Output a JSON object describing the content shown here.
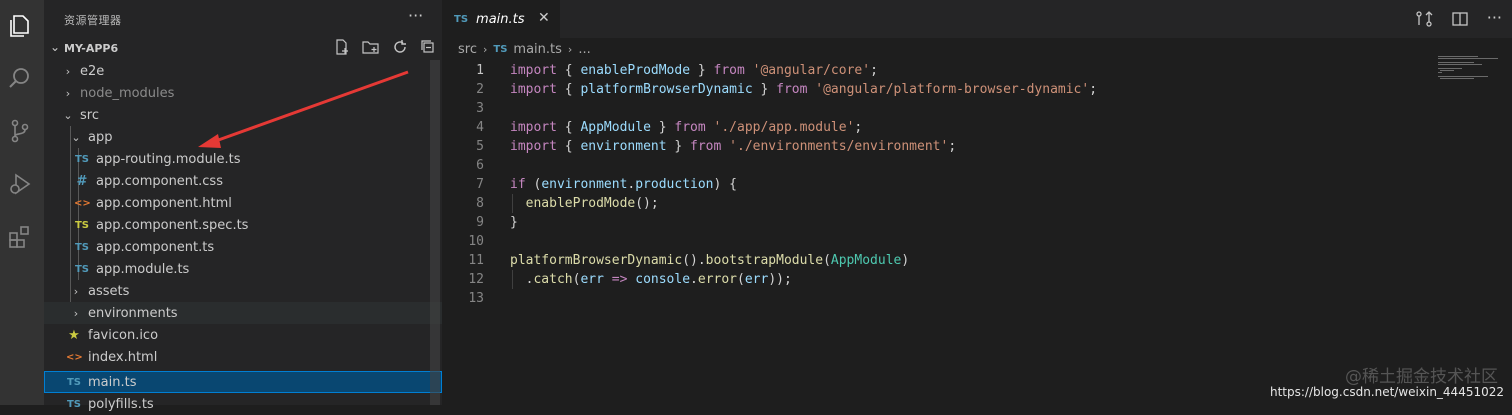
{
  "sidebar": {
    "title": "资源管理器",
    "more": "···",
    "section_title": "MY-APP6",
    "items": [
      {
        "label": "e2e",
        "chev": "›",
        "icon": ""
      },
      {
        "label": "node_modules",
        "chev": "›",
        "icon": ""
      },
      {
        "label": "src",
        "chev": "⌄",
        "icon": ""
      },
      {
        "label": "app",
        "chev": "⌄",
        "icon": ""
      },
      {
        "label": "app-routing.module.ts",
        "chev": "",
        "icon": "TS"
      },
      {
        "label": "app.component.css",
        "chev": "",
        "icon": "#"
      },
      {
        "label": "app.component.html",
        "chev": "",
        "icon": "<>"
      },
      {
        "label": "app.component.spec.ts",
        "chev": "",
        "icon": "TS"
      },
      {
        "label": "app.component.ts",
        "chev": "",
        "icon": "TS"
      },
      {
        "label": "app.module.ts",
        "chev": "",
        "icon": "TS"
      },
      {
        "label": "assets",
        "chev": "›",
        "icon": ""
      },
      {
        "label": "environments",
        "chev": "›",
        "icon": ""
      },
      {
        "label": "favicon.ico",
        "chev": "",
        "icon": "★"
      },
      {
        "label": "index.html",
        "chev": "",
        "icon": "<>"
      },
      {
        "label": "main.ts",
        "chev": "",
        "icon": "TS"
      },
      {
        "label": "polyfills.ts",
        "chev": "",
        "icon": "TS"
      }
    ]
  },
  "editor": {
    "tab_icon": "TS",
    "tab_label": "main.ts",
    "tab_close": "✕",
    "breadcrumb": [
      "src",
      "main.ts",
      "..."
    ],
    "breadcrumb_icon": "TS",
    "lines": [
      {
        "n": "1",
        "tokens": [
          [
            "kw",
            "import"
          ],
          [
            "pl",
            " { "
          ],
          [
            "var",
            "enableProdMode"
          ],
          [
            "pl",
            " } "
          ],
          [
            "kw",
            "from"
          ],
          [
            "pl",
            " "
          ],
          [
            "str",
            "'@angular/core'"
          ],
          [
            "pl",
            ";"
          ]
        ]
      },
      {
        "n": "2",
        "tokens": [
          [
            "kw",
            "import"
          ],
          [
            "pl",
            " { "
          ],
          [
            "var",
            "platformBrowserDynamic"
          ],
          [
            "pl",
            " } "
          ],
          [
            "kw",
            "from"
          ],
          [
            "pl",
            " "
          ],
          [
            "str",
            "'@angular/platform-browser-dynamic'"
          ],
          [
            "pl",
            ";"
          ]
        ]
      },
      {
        "n": "3",
        "tokens": []
      },
      {
        "n": "4",
        "tokens": [
          [
            "kw",
            "import"
          ],
          [
            "pl",
            " { "
          ],
          [
            "var",
            "AppModule"
          ],
          [
            "pl",
            " } "
          ],
          [
            "kw",
            "from"
          ],
          [
            "pl",
            " "
          ],
          [
            "str",
            "'./app/app.module'"
          ],
          [
            "pl",
            ";"
          ]
        ]
      },
      {
        "n": "5",
        "tokens": [
          [
            "kw",
            "import"
          ],
          [
            "pl",
            " { "
          ],
          [
            "var",
            "environment"
          ],
          [
            "pl",
            " } "
          ],
          [
            "kw",
            "from"
          ],
          [
            "pl",
            " "
          ],
          [
            "str",
            "'./environments/environment'"
          ],
          [
            "pl",
            ";"
          ]
        ]
      },
      {
        "n": "6",
        "tokens": []
      },
      {
        "n": "7",
        "tokens": [
          [
            "kw",
            "if"
          ],
          [
            "pl",
            " ("
          ],
          [
            "var",
            "environment"
          ],
          [
            "pl",
            "."
          ],
          [
            "var",
            "production"
          ],
          [
            "pl",
            ") {"
          ]
        ]
      },
      {
        "n": "8",
        "tokens": [
          [
            "pl",
            "  "
          ],
          [
            "fn",
            "enableProdMode"
          ],
          [
            "pl",
            "();"
          ]
        ]
      },
      {
        "n": "9",
        "tokens": [
          [
            "pl",
            "}"
          ]
        ]
      },
      {
        "n": "10",
        "tokens": []
      },
      {
        "n": "11",
        "tokens": [
          [
            "fn",
            "platformBrowserDynamic"
          ],
          [
            "pl",
            "()."
          ],
          [
            "fn",
            "bootstrapModule"
          ],
          [
            "pl",
            "("
          ],
          [
            "cls",
            "AppModule"
          ],
          [
            "pl",
            ")"
          ]
        ]
      },
      {
        "n": "12",
        "tokens": [
          [
            "pl",
            "  ."
          ],
          [
            "fn",
            "catch"
          ],
          [
            "pl",
            "("
          ],
          [
            "var",
            "err"
          ],
          [
            "pl",
            " "
          ],
          [
            "kw",
            "=>"
          ],
          [
            "pl",
            " "
          ],
          [
            "var",
            "console"
          ],
          [
            "pl",
            "."
          ],
          [
            "fn",
            "error"
          ],
          [
            "pl",
            "("
          ],
          [
            "var",
            "err"
          ],
          [
            "pl",
            "));"
          ]
        ]
      },
      {
        "n": "13",
        "tokens": []
      }
    ]
  },
  "watermark": "https://blog.csdn.net/weixin_44451022",
  "watermark_cn": "@稀土掘金技术社区"
}
